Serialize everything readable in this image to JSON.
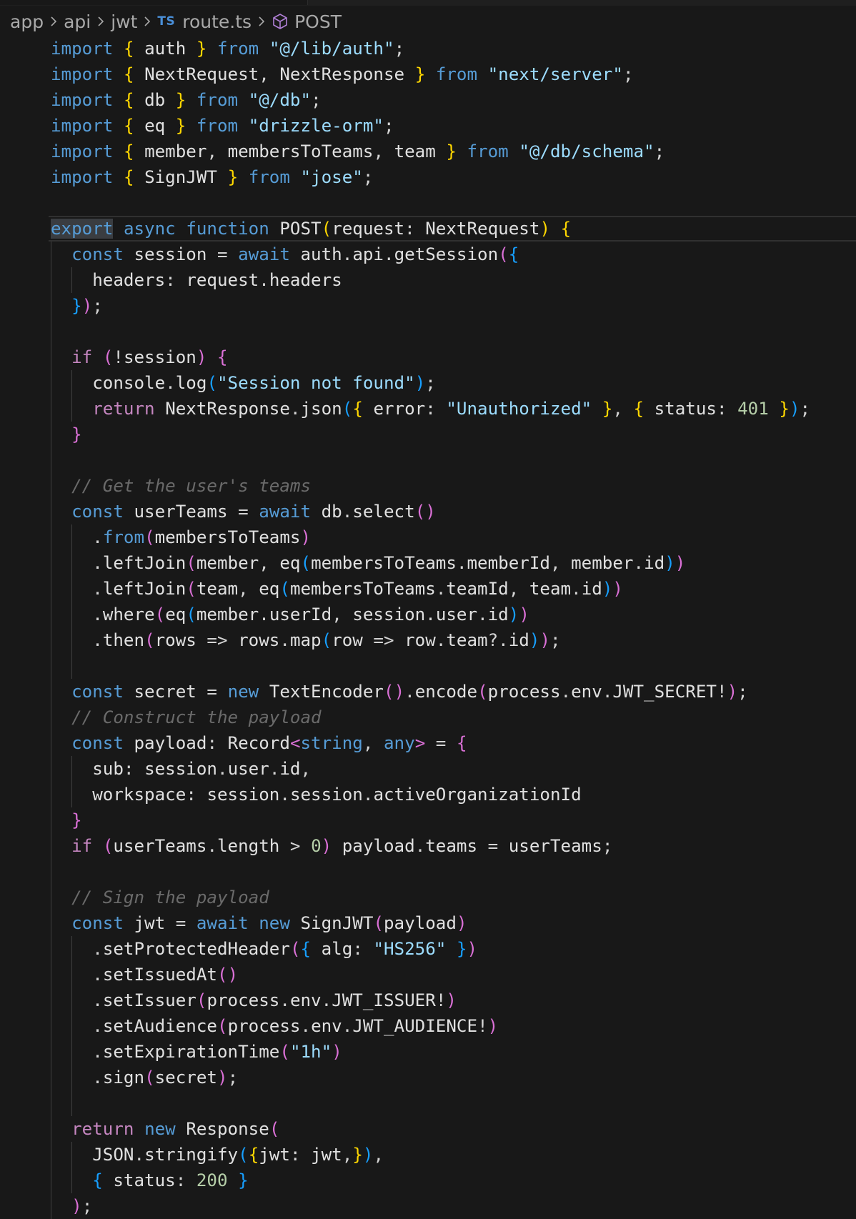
{
  "breadcrumb": {
    "items": [
      "app",
      "api",
      "jwt"
    ],
    "file_badge": "TS",
    "file_name": "route.ts",
    "symbol": "POST",
    "symbol_icon": "cube-icon"
  },
  "editor": {
    "language": "typescript",
    "lines": [
      "import { auth } from \"@/lib/auth\";",
      "import { NextRequest, NextResponse } from \"next/server\";",
      "import { db } from \"@/db\";",
      "import { eq } from \"drizzle-orm\";",
      "import { member, membersToTeams, team } from \"@/db/schema\";",
      "import { SignJWT } from \"jose\";",
      "",
      "export async function POST(request: NextRequest) {",
      "  const session = await auth.api.getSession({",
      "    headers: request.headers",
      "  });",
      "",
      "  if (!session) {",
      "    console.log(\"Session not found\");",
      "    return NextResponse.json({ error: \"Unauthorized\" }, { status: 401 });",
      "  }",
      "",
      "  // Get the user's teams",
      "  const userTeams = await db.select()",
      "    .from(membersToTeams)",
      "    .leftJoin(member, eq(membersToTeams.memberId, member.id))",
      "    .leftJoin(team, eq(membersToTeams.teamId, team.id))",
      "    .where(eq(member.userId, session.user.id))",
      "    .then(rows => rows.map(row => row.team?.id));",
      "",
      "  const secret = new TextEncoder().encode(process.env.JWT_SECRET!);",
      "  // Construct the payload",
      "  const payload: Record<string, any> = {",
      "    sub: session.user.id,",
      "    workspace: session.session.activeOrganizationId",
      "  }",
      "  if (userTeams.length > 0) payload.teams = userTeams;",
      "",
      "  // Sign the payload",
      "  const jwt = await new SignJWT(payload)",
      "    .setProtectedHeader({ alg: \"HS256\" })",
      "    .setIssuedAt()",
      "    .setIssuer(process.env.JWT_ISSUER!)",
      "    .setAudience(process.env.JWT_AUDIENCE!)",
      "    .setExpirationTime(\"1h\")",
      "    .sign(secret);",
      "",
      "  return new Response(",
      "    JSON.stringify({jwt: jwt,}),",
      "    { status: 200 }",
      "  );"
    ]
  },
  "colors": {
    "background": "#181818",
    "keyword": "#569cd6",
    "control": "#c586c0",
    "string": "#9cdcfe",
    "comment": "#6a6a6a",
    "bracket_gold": "#ffd700",
    "bracket_orchid": "#da70d6",
    "bracket_blue": "#179fff"
  }
}
